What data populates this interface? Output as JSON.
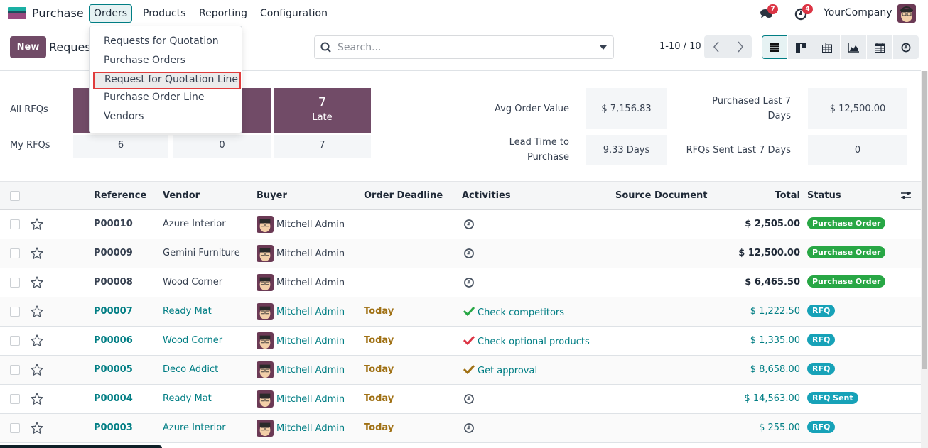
{
  "navbar": {
    "app_name": "Purchase",
    "menus": [
      "Orders",
      "Products",
      "Reporting",
      "Configuration"
    ],
    "active_menu": "Orders",
    "messages_count": "7",
    "activities_count": "4",
    "company": "YourCompany"
  },
  "orders_menu": {
    "items": [
      "Requests for Quotation",
      "Purchase Orders",
      "Request for Quotation Line",
      "Purchase Order Line",
      "Vendors"
    ],
    "highlighted": "Request for Quotation Line"
  },
  "control_panel": {
    "new_label": "New",
    "breadcrumb": "Reques",
    "search_placeholder": "Search...",
    "pager": "1-10 / 10",
    "views": [
      "list",
      "kanban",
      "pivot",
      "graph",
      "calendar",
      "activity"
    ],
    "active_view": "list"
  },
  "dashboard": {
    "row_labels": [
      "All RFQs",
      "My RFQs"
    ],
    "cards": [
      {
        "value": "",
        "label": "",
        "my_value": "6"
      },
      {
        "value": "",
        "label": "",
        "my_value": "0"
      },
      {
        "value": "7",
        "label": "Late",
        "my_value": "7"
      }
    ],
    "kpis": [
      {
        "label": "Avg Order Value",
        "value": "$ 7,156.83"
      },
      {
        "label": "Purchased Last 7 Days",
        "value": "$ 12,500.00"
      },
      {
        "label": "Lead Time to Purchase",
        "value": "9.33 Days"
      },
      {
        "label": "RFQs Sent Last 7 Days",
        "value": "0"
      }
    ]
  },
  "table": {
    "columns": [
      "Reference",
      "Vendor",
      "Buyer",
      "Order Deadline",
      "Activities",
      "Source Document",
      "Total",
      "Status"
    ],
    "rows": [
      {
        "reference": "P00010",
        "vendor": "Azure Interior",
        "buyer": "Mitchell Admin",
        "deadline": "",
        "activity": "",
        "activity_icon": "clock",
        "source": "",
        "total": "$ 2,505.00",
        "status": "Purchase Order",
        "status_color": "#28a745"
      },
      {
        "reference": "P00009",
        "vendor": "Gemini Furniture",
        "buyer": "Mitchell Admin",
        "deadline": "",
        "activity": "",
        "activity_icon": "clock",
        "source": "",
        "total": "$ 12,500.00",
        "status": "Purchase Order",
        "status_color": "#28a745"
      },
      {
        "reference": "P00008",
        "vendor": "Wood Corner",
        "buyer": "Mitchell Admin",
        "deadline": "",
        "activity": "",
        "activity_icon": "clock",
        "source": "",
        "total": "$ 6,465.50",
        "status": "Purchase Order",
        "status_color": "#28a745"
      },
      {
        "reference": "P00007",
        "vendor": "Ready Mat",
        "buyer": "Mitchell Admin",
        "deadline": "Today",
        "activity": "Check competitors",
        "activity_icon": "check",
        "activity_color": "#28a745",
        "source": "",
        "total": "$ 1,222.50",
        "status": "RFQ",
        "status_color": "#17a2b8"
      },
      {
        "reference": "P00006",
        "vendor": "Wood Corner",
        "buyer": "Mitchell Admin",
        "deadline": "Today",
        "activity": "Check optional products",
        "activity_icon": "check",
        "activity_color": "#dc3545",
        "source": "",
        "total": "$ 1,335.00",
        "status": "RFQ",
        "status_color": "#17a2b8"
      },
      {
        "reference": "P00005",
        "vendor": "Deco Addict",
        "buyer": "Mitchell Admin",
        "deadline": "Today",
        "activity": "Get approval",
        "activity_icon": "check",
        "activity_color": "#a07115",
        "source": "",
        "total": "$ 8,658.00",
        "status": "RFQ",
        "status_color": "#17a2b8"
      },
      {
        "reference": "P00004",
        "vendor": "Ready Mat",
        "buyer": "Mitchell Admin",
        "deadline": "Today",
        "activity": "",
        "activity_icon": "clock",
        "source": "",
        "total": "$ 14,563.00",
        "status": "RFQ Sent",
        "status_color": "#17a2b8"
      },
      {
        "reference": "P00003",
        "vendor": "Azure Interior",
        "buyer": "Mitchell Admin",
        "deadline": "Today",
        "activity": "",
        "activity_icon": "clock",
        "source": "",
        "total": "$ 255.00",
        "status": "RFQ",
        "status_color": "#17a2b8"
      }
    ]
  }
}
